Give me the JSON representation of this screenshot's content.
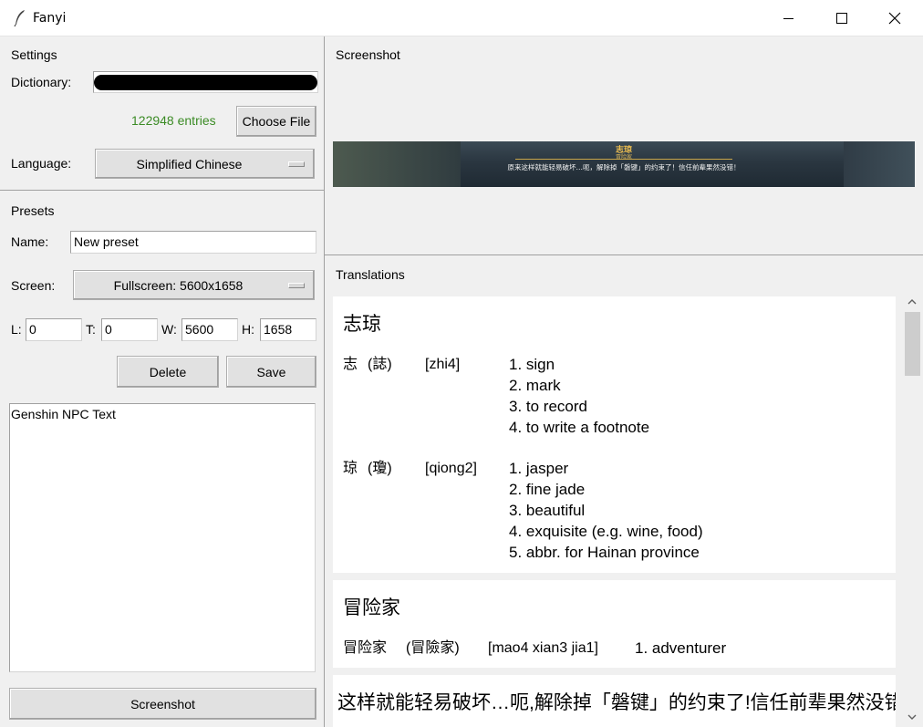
{
  "window": {
    "title": "Fanyi"
  },
  "settings": {
    "section_title": "Settings",
    "dictionary_label": "Dictionary:",
    "entries_text": "122948 entries",
    "entries_color": "#3b8b25",
    "choose_file_label": "Choose File",
    "language_label": "Language:",
    "language_value": "Simplified Chinese"
  },
  "presets": {
    "section_title": "Presets",
    "name_label": "Name:",
    "name_value": "New preset",
    "screen_label": "Screen:",
    "screen_value": "Fullscreen: 5600x1658",
    "l_label": "L:",
    "l_value": "0",
    "t_label": "T:",
    "t_value": "0",
    "w_label": "W:",
    "w_value": "5600",
    "h_label": "H:",
    "h_value": "1658",
    "delete_label": "Delete",
    "save_label": "Save",
    "list_items": [
      "Genshin NPC Text"
    ]
  },
  "screenshot_button_label": "Screenshot",
  "screenshot_panel": {
    "title": "Screenshot",
    "speaker": "志琼",
    "speaker_title": "冒险家",
    "subtitle": "原来这样就能轻易破坏…呃，解除掉「磐键」的约束了！信任前辈果然没错！"
  },
  "translations": {
    "title": "Translations",
    "cards": [
      {
        "headword": "志琼",
        "entries": [
          {
            "simplified": "志",
            "traditional": "(誌)",
            "pinyin": "[zhi4]",
            "defs": [
              "1. sign",
              "2. mark",
              "3. to record",
              "4. to write a footnote"
            ]
          },
          {
            "simplified": "琼",
            "traditional": "(瓊)",
            "pinyin": "[qiong2]",
            "defs": [
              "1. jasper",
              "2. fine jade",
              "3. beautiful",
              "4. exquisite (e.g. wine, food)",
              "5. abbr. for Hainan province"
            ]
          }
        ]
      },
      {
        "headword": "冒险家",
        "entries": [
          {
            "simplified": "冒险家",
            "traditional": "(冒險家)",
            "pinyin": "[mao4 xian3 jia1]",
            "defs": [
              "1. adventurer"
            ]
          }
        ]
      },
      {
        "headword": "这样就能轻易破坏…呃,解除掉「磐键」的约束了!信任前辈果然没错!"
      }
    ]
  }
}
